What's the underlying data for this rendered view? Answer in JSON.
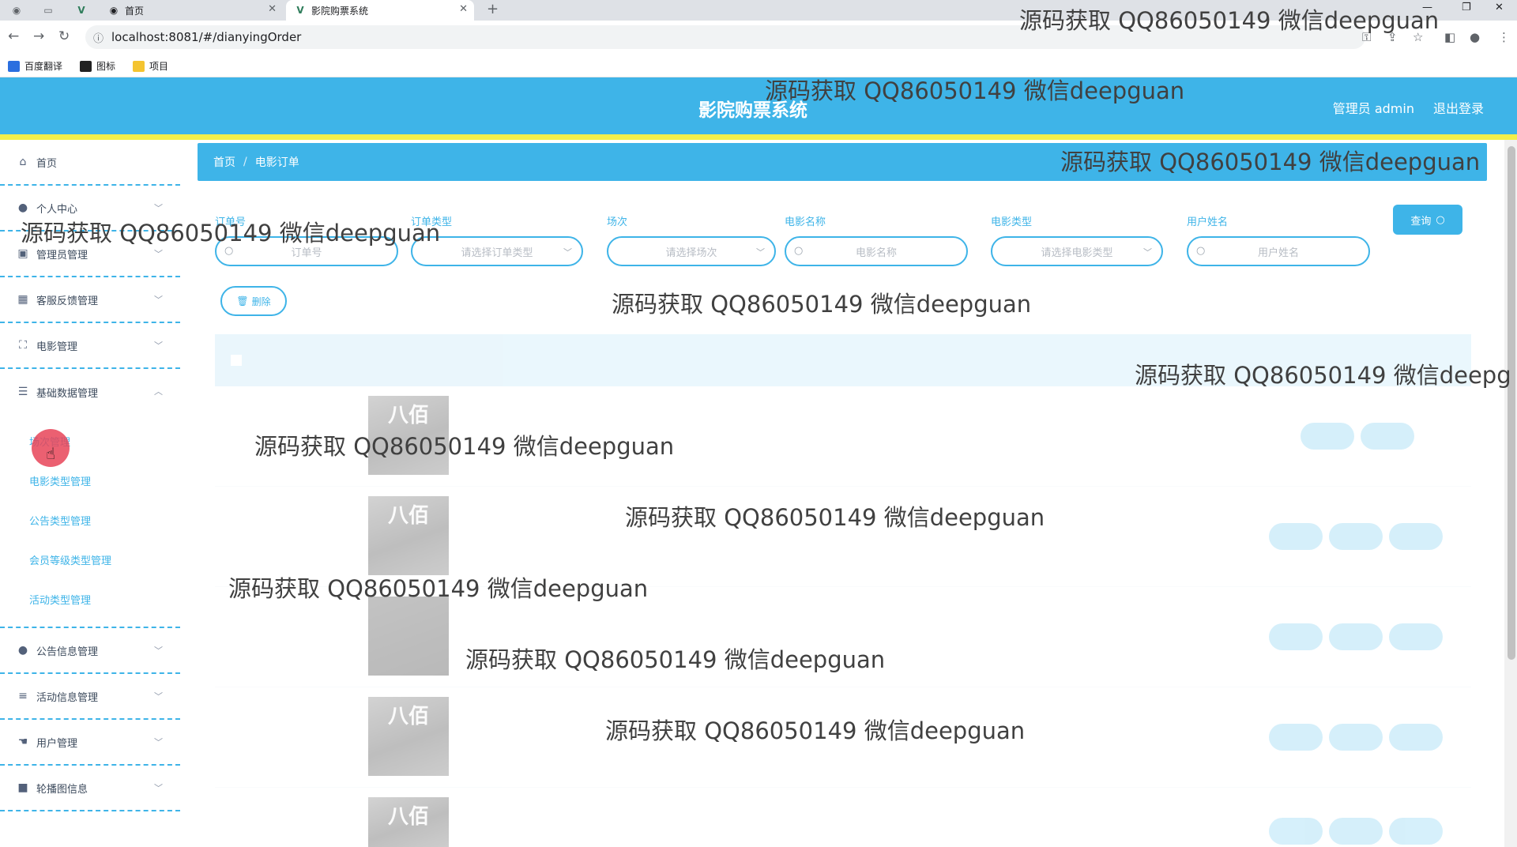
{
  "browser": {
    "tabs": [
      {
        "title": "首页",
        "icon": "globe-icon",
        "active": false
      },
      {
        "title": "影院购票系统",
        "icon": "v-logo-icon",
        "active": true
      }
    ],
    "new_tab": "+",
    "url": "localhost:8081/#/dianyingOrder",
    "bookmarks": [
      {
        "label": "百度翻译",
        "color": "#2b6fdf"
      },
      {
        "label": "图标",
        "color": "#222222"
      },
      {
        "label": "项目",
        "color": "#f4c430"
      }
    ]
  },
  "header": {
    "title": "影院购票系统",
    "user": "管理员 admin",
    "logout": "退出登录",
    "color": "#3eb4e8",
    "stripe_color": "#f3ef49"
  },
  "sidebar": {
    "items": [
      {
        "label": "首页",
        "icon": "home-icon"
      },
      {
        "label": "个人中心",
        "icon": "user-icon"
      },
      {
        "label": "管理员管理",
        "icon": "admin-icon"
      },
      {
        "label": "客服反馈管理",
        "icon": "grid-icon"
      },
      {
        "label": "电影管理",
        "icon": "frame-icon"
      },
      {
        "label": "基础数据管理",
        "icon": "sliders-icon"
      }
    ],
    "sub_items": [
      "场次管理",
      "电影类型管理",
      "公告类型管理",
      "会员等级类型管理",
      "活动类型管理"
    ],
    "items_after": [
      {
        "label": "公告信息管理",
        "icon": "user-icon"
      },
      {
        "label": "活动信息管理",
        "icon": "list-icon"
      },
      {
        "label": "用户管理",
        "icon": "thumb-icon"
      },
      {
        "label": "轮播图信息",
        "icon": "video-icon"
      }
    ]
  },
  "breadcrumb": {
    "home": "首页",
    "current": "电影订单"
  },
  "filters": [
    {
      "label": "订单号",
      "placeholder": "订单号"
    },
    {
      "label": "订单类型",
      "placeholder": "请选择订单类型"
    },
    {
      "label": "场次",
      "placeholder": "请选择场次"
    },
    {
      "label": "电影名称",
      "placeholder": "电影名称"
    },
    {
      "label": "电影类型",
      "placeholder": "请选择电影类型"
    },
    {
      "label": "用户姓名",
      "placeholder": "用户姓名"
    }
  ],
  "buttons": {
    "query": "查询",
    "delete": "删除"
  },
  "poster_text": "八佰",
  "watermark": "源码获取 QQ86050149 微信deepguan",
  "watermark_clipped": "源码获取 QQ86050149 微信deepg"
}
